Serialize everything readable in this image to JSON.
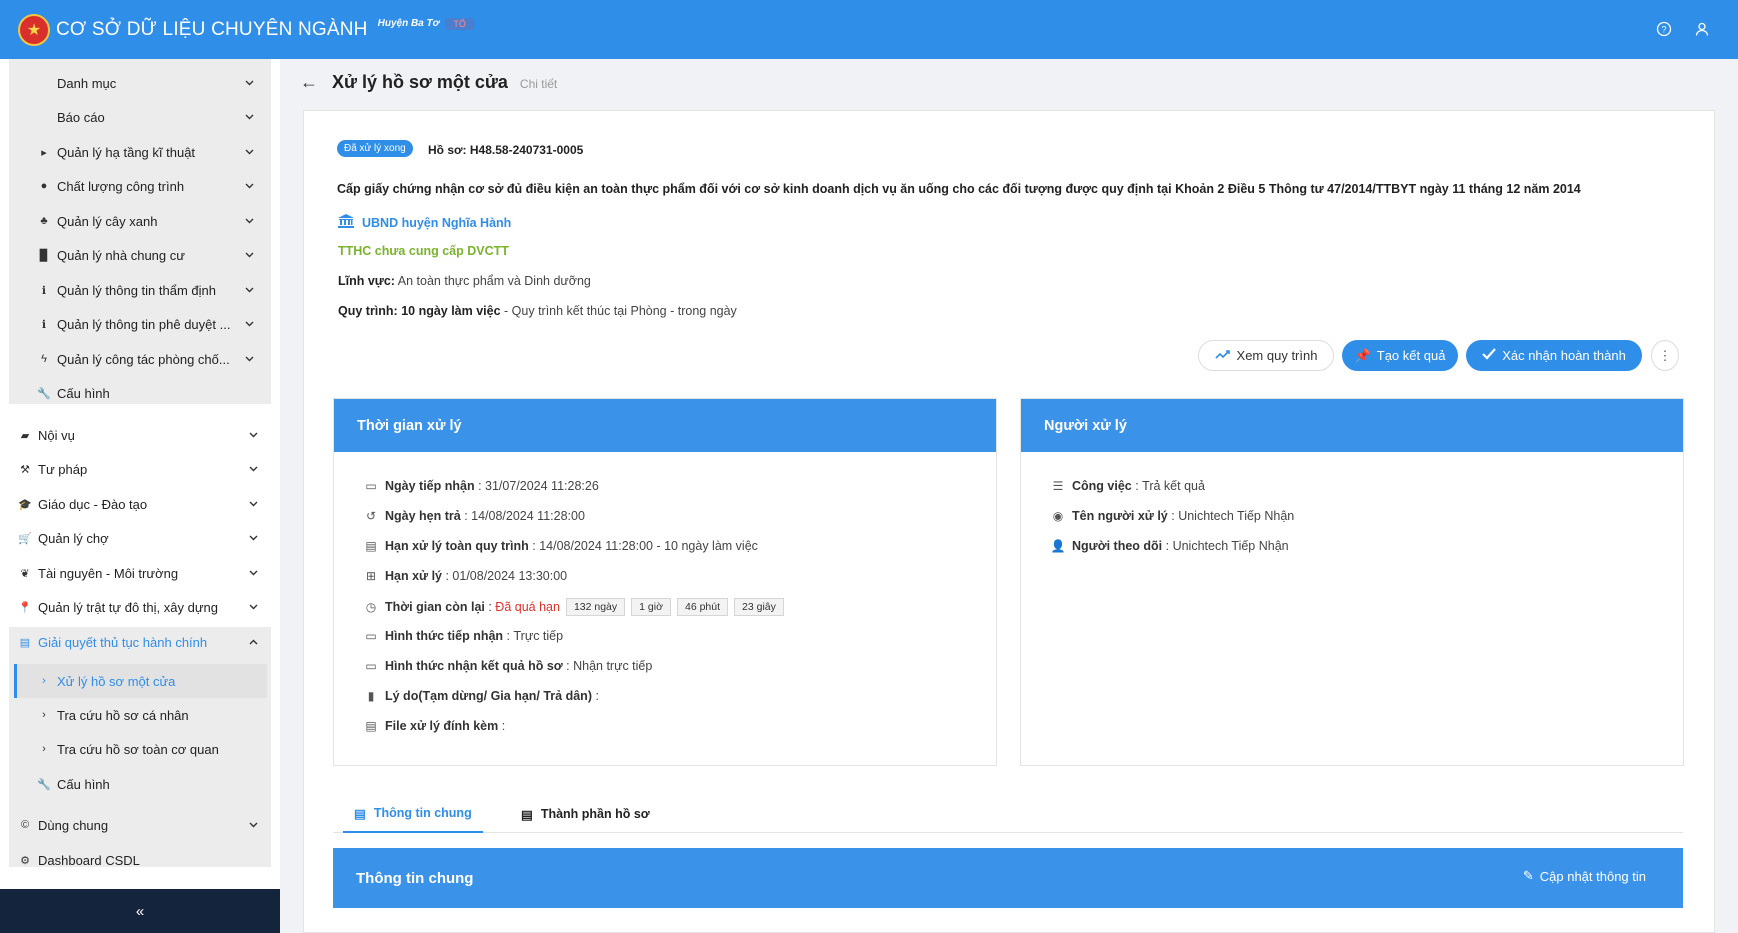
{
  "header": {
    "title": "CƠ SỞ DỮ LIỆU CHUYÊN NGÀNH",
    "subtitle": "Huyện Ba Tơ",
    "badge": "TỔ"
  },
  "sidebar": {
    "group_items": [
      {
        "label": "Danh mục"
      },
      {
        "label": "Báo cáo"
      },
      {
        "label": "Quản lý hạ tầng kĩ thuật"
      },
      {
        "label": "Chất lượng công trình"
      },
      {
        "label": "Quản lý cây xanh"
      },
      {
        "label": "Quản lý nhà chung cư"
      },
      {
        "label": "Quản lý thông tin thẩm định"
      },
      {
        "label": "Quản lý thông tin phê duyệt ..."
      },
      {
        "label": "Quản lý công tác phòng chố..."
      },
      {
        "label": "Cấu hình"
      }
    ],
    "items": [
      {
        "label": "Nội vụ"
      },
      {
        "label": "Tư pháp"
      },
      {
        "label": "Giáo dục - Đào tạo"
      },
      {
        "label": "Quản lý chợ"
      },
      {
        "label": "Tài nguyên - Môi trường"
      },
      {
        "label": "Quản lý trật tự đô thị, xây dựng"
      },
      {
        "label": "Giải quyết thủ tục hành chính"
      }
    ],
    "sub_items": [
      {
        "label": "Xử lý hồ sơ một cửa"
      },
      {
        "label": "Tra cứu hồ sơ cá nhân"
      },
      {
        "label": "Tra cứu hồ sơ toàn cơ quan"
      },
      {
        "label": "Cấu hình"
      }
    ],
    "bottom_items": [
      {
        "label": "Dùng chung"
      },
      {
        "label": "Dashboard CSDL"
      }
    ],
    "collapse": "«"
  },
  "page": {
    "title": "Xử lý hồ sơ một cửa",
    "subtitle": "Chi tiết"
  },
  "record": {
    "status": "Đã xử lý xong",
    "code_label": "Hồ sơ:",
    "code": "H48.58-240731-0005",
    "procedure": "Cấp giấy chứng nhận cơ sở đủ điều kiện an toàn thực phẩm đối với cơ sở kinh doanh dịch vụ ăn uống cho các đối tượng được quy định tại Khoản 2 Điều 5 Thông tư 47/2014/TTBYT ngày 11 tháng 12 năm 2014",
    "agency": "UBND huyện Nghĩa Hành",
    "tthc": "TTHC chưa cung cấp DVCTT",
    "field_label": "Lĩnh vực:",
    "field_value": "An toàn thực phẩm và Dinh dưỡng",
    "process_label": "Quy trình: 10 ngày làm việc",
    "process_value": " - Quy trình kết thúc tại Phòng - trong ngày"
  },
  "actions": {
    "view_process": "Xem quy trình",
    "create_result": "Tạo kết quả",
    "confirm_done": "Xác nhận hoàn thành"
  },
  "time_panel": {
    "title": "Thời gian xử lý",
    "received_label": "Ngày tiếp nhận",
    "received_value": "31/07/2024 11:28:26",
    "due_label": "Ngày hẹn trả",
    "due_value": "14/08/2024 11:28:00",
    "process_due_label": "Hạn xử lý toàn quy trình",
    "process_due_value": "14/08/2024 11:28:00 - 10 ngày làm việc",
    "deadline_label": "Hạn xử lý",
    "deadline_value": "01/08/2024 13:30:00",
    "remaining_label": "Thời gian còn lại",
    "remaining_status": "Đã quá hạn",
    "remaining_chips": [
      "132 ngày",
      "1 giờ",
      "46 phút",
      "23 giây"
    ],
    "receive_method_label": "Hình thức tiếp nhận",
    "receive_method_value": "Trực tiếp",
    "result_method_label": "Hình thức nhận kết quả hồ sơ",
    "result_method_value": "Nhận trực tiếp",
    "reason_label": "Lý do(Tạm dừng/ Gia hạn/ Trả dân)",
    "file_label": "File xử lý đính kèm"
  },
  "handler_panel": {
    "title": "Người xử lý",
    "task_label": "Công việc",
    "task_value": "Trả kết quả",
    "handler_label": "Tên người xử lý",
    "handler_value": "Unichtech Tiếp Nhận",
    "follower_label": "Người theo dõi",
    "follower_value": "Unichtech Tiếp Nhận"
  },
  "tabs": [
    {
      "label": "Thông tin chung"
    },
    {
      "label": "Thành phần hồ sơ"
    }
  ],
  "info_section": {
    "title": "Thông tin chung",
    "update": "Cập nhật thông tin"
  },
  "colors": {
    "primary": "#2f8ee8",
    "sidebar_footer": "#14243c",
    "overdue": "#e0302a",
    "tthc": "#7ab32e"
  }
}
